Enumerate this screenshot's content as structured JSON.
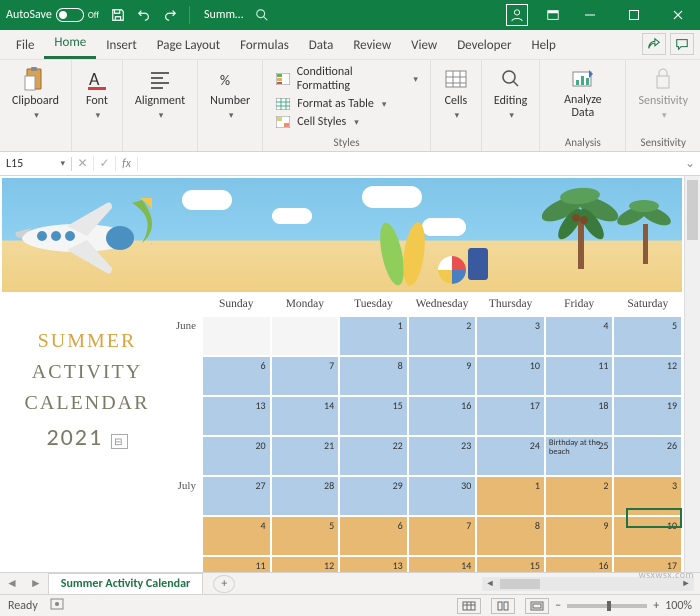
{
  "titlebar": {
    "autosave_label": "AutoSave",
    "autosave_state": "Off",
    "doc_name": "Summ…"
  },
  "tabs": {
    "file": "File",
    "home": "Home",
    "insert": "Insert",
    "page_layout": "Page Layout",
    "formulas": "Formulas",
    "data": "Data",
    "review": "Review",
    "view": "View",
    "developer": "Developer",
    "help": "Help"
  },
  "ribbon": {
    "clipboard": "Clipboard",
    "font": "Font",
    "alignment": "Alignment",
    "number": "Number",
    "styles": "Styles",
    "cond_format": "Conditional Formatting",
    "format_table": "Format as Table",
    "cell_styles": "Cell Styles",
    "cells": "Cells",
    "editing": "Editing",
    "analyze": "Analyze Data",
    "analysis": "Analysis",
    "sensitivity": "Sensitivity",
    "sensitivity_grp": "Sensitivity"
  },
  "fbar": {
    "name": "L15",
    "fx": "fx",
    "value": ""
  },
  "calendar": {
    "sidetitle": {
      "l1": "SUMMER",
      "l2": "ACTIVITY",
      "l3": "CALENDAR",
      "l4": "2021"
    },
    "dow": [
      "Sunday",
      "Monday",
      "Tuesday",
      "Wednesday",
      "Thursday",
      "Friday",
      "Saturday"
    ],
    "months": {
      "june": "June",
      "july": "July"
    },
    "weeks": [
      {
        "month": "June",
        "style": "blue",
        "cells": [
          null,
          null,
          "1",
          "2",
          "3",
          "4",
          "5"
        ]
      },
      {
        "month": "",
        "style": "blue",
        "cells": [
          "6",
          "7",
          "8",
          "9",
          "10",
          "11",
          "12"
        ]
      },
      {
        "month": "",
        "style": "blue",
        "cells": [
          "13",
          "14",
          "15",
          "16",
          "17",
          "18",
          "19"
        ]
      },
      {
        "month": "",
        "style": "blue",
        "cells": [
          "20",
          "21",
          "22",
          "23",
          "24",
          "25",
          "26"
        ],
        "notes": {
          "5": "Birthday at the beach"
        }
      },
      {
        "month": "July",
        "style": "mix",
        "cells": [
          "27",
          "28",
          "29",
          "30",
          "1",
          "2",
          "3"
        ]
      },
      {
        "month": "",
        "style": "orange",
        "cells": [
          "4",
          "5",
          "6",
          "7",
          "8",
          "9",
          "10"
        ]
      },
      {
        "month": "",
        "style": "orange",
        "cells": [
          "11",
          "12",
          "13",
          "14",
          "15",
          "16",
          "17"
        ]
      }
    ]
  },
  "sheettab": {
    "name": "Summer Activity Calendar"
  },
  "status": {
    "ready": "Ready",
    "zoom": "100%"
  },
  "watermark": "wsxwsx.com"
}
